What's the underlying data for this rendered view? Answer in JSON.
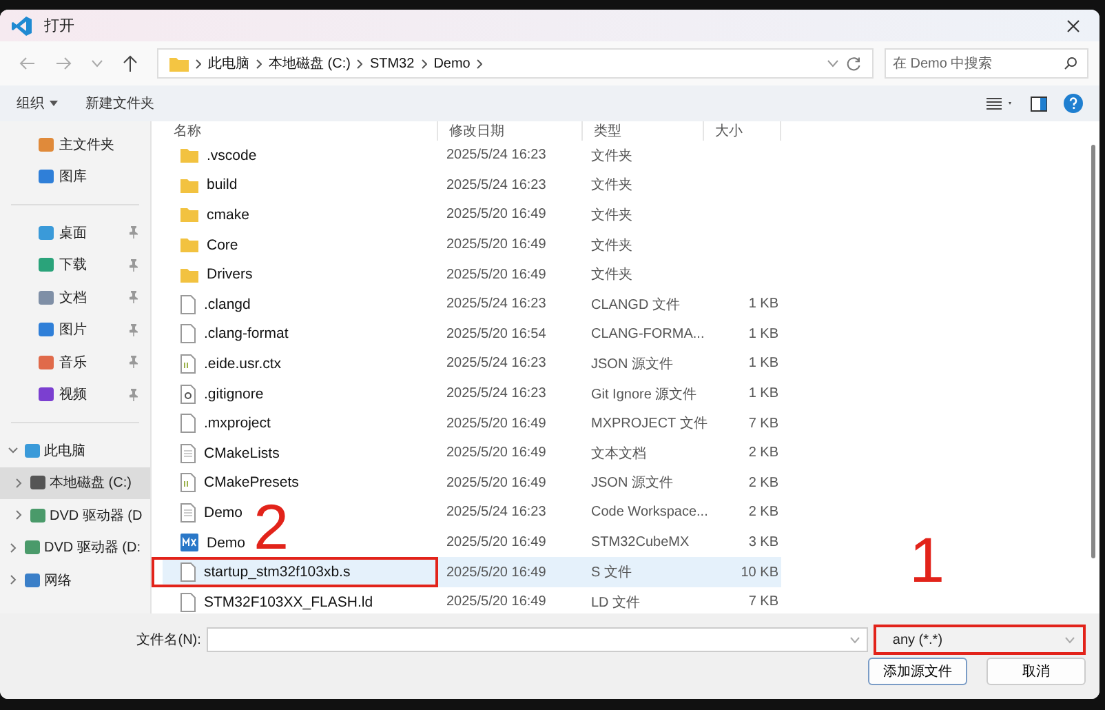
{
  "window": {
    "title": "打开"
  },
  "nav": {
    "path": [
      "此电脑",
      "本地磁盘 (C:)",
      "STM32",
      "Demo"
    ],
    "search": {
      "placeholder": "在 Demo 中搜索"
    }
  },
  "toolbar": {
    "organize": "组织",
    "new_folder": "新建文件夹"
  },
  "sidebar": {
    "items": [
      {
        "label": "主文件夹",
        "pinned": false
      },
      {
        "label": "图库",
        "pinned": false
      },
      {
        "label": "桌面",
        "pinned": true
      },
      {
        "label": "下载",
        "pinned": true
      },
      {
        "label": "文档",
        "pinned": true
      },
      {
        "label": "图片",
        "pinned": true
      },
      {
        "label": "音乐",
        "pinned": true
      },
      {
        "label": "视频",
        "pinned": true
      }
    ],
    "tree": [
      {
        "label": "此电脑",
        "expanded": true,
        "selected": false,
        "children": [
          {
            "label": "本地磁盘 (C:)",
            "expanded": false,
            "selected": true
          },
          {
            "label": "DVD 驱动器 (D",
            "expanded": false,
            "selected": false
          }
        ]
      },
      {
        "label": "DVD 驱动器 (D:",
        "expanded": false,
        "selected": false
      },
      {
        "label": "网络",
        "expanded": false,
        "selected": false
      }
    ]
  },
  "table": {
    "columns": [
      "名称",
      "修改日期",
      "类型",
      "大小"
    ],
    "rows": [
      {
        "name": ".vscode",
        "kind": "folder",
        "date": "2025/5/24 16:23",
        "type": "文件夹",
        "selected": false,
        "boxed": false
      },
      {
        "name": "build",
        "kind": "folder",
        "date": "2025/5/24 16:23",
        "type": "文件夹",
        "selected": false,
        "boxed": false
      },
      {
        "name": "cmake",
        "kind": "folder",
        "date": "2025/5/20 16:49",
        "type": "文件夹",
        "selected": false,
        "boxed": false
      },
      {
        "name": "Core",
        "kind": "folder",
        "date": "2025/5/20 16:49",
        "type": "文件夹",
        "selected": false,
        "boxed": false
      },
      {
        "name": "Drivers",
        "kind": "folder",
        "date": "2025/5/20 16:49",
        "type": "文件夹",
        "selected": false,
        "boxed": false
      },
      {
        "name": ".clangd",
        "kind": "file",
        "date": "2025/5/24 16:23",
        "type": "CLANGD 文件",
        "size": "1 KB",
        "selected": false,
        "boxed": false
      },
      {
        "name": ".clang-format",
        "kind": "file",
        "date": "2025/5/20 16:54",
        "type": "CLANG-FORMA...",
        "size": "1 KB",
        "selected": false,
        "boxed": false
      },
      {
        "name": ".eide.usr.ctx",
        "kind": "json",
        "date": "2025/5/24 16:23",
        "type": "JSON 源文件",
        "size": "1 KB",
        "selected": false,
        "boxed": false
      },
      {
        "name": ".gitignore",
        "kind": "gear",
        "date": "2025/5/24 16:23",
        "type": "Git Ignore 源文件",
        "size": "1 KB",
        "selected": false,
        "boxed": false
      },
      {
        "name": ".mxproject",
        "kind": "file",
        "date": "2025/5/20 16:49",
        "type": "MXPROJECT 文件",
        "size": "7 KB",
        "selected": false,
        "boxed": false
      },
      {
        "name": "CMakeLists",
        "kind": "text",
        "date": "2025/5/20 16:49",
        "type": "文本文档",
        "size": "2 KB",
        "selected": false,
        "boxed": false
      },
      {
        "name": "CMakePresets",
        "kind": "json",
        "date": "2025/5/20 16:49",
        "type": "JSON 源文件",
        "size": "2 KB",
        "selected": false,
        "boxed": false
      },
      {
        "name": "Demo",
        "kind": "text",
        "date": "2025/5/24 16:23",
        "type": "Code Workspace...",
        "size": "2 KB",
        "selected": false,
        "boxed": false
      },
      {
        "name": "Demo",
        "kind": "mx",
        "date": "2025/5/20 16:49",
        "type": "STM32CubeMX",
        "size": "3 KB",
        "selected": false,
        "boxed": false
      },
      {
        "name": "startup_stm32f103xb.s",
        "kind": "file",
        "date": "2025/5/20 16:49",
        "type": "S 文件",
        "size": "10 KB",
        "selected": true,
        "boxed": true
      },
      {
        "name": "STM32F103XX_FLASH.ld",
        "kind": "file",
        "date": "2025/5/20 16:49",
        "type": "LD 文件",
        "size": "7 KB",
        "selected": false,
        "boxed": false
      }
    ]
  },
  "footer": {
    "filename_label": "文件名(N):",
    "filter": {
      "value": "any (*.*)",
      "boxed": true
    },
    "buttons": [
      "添加源文件",
      "取消"
    ]
  },
  "annotations": [
    "2",
    "1"
  ]
}
